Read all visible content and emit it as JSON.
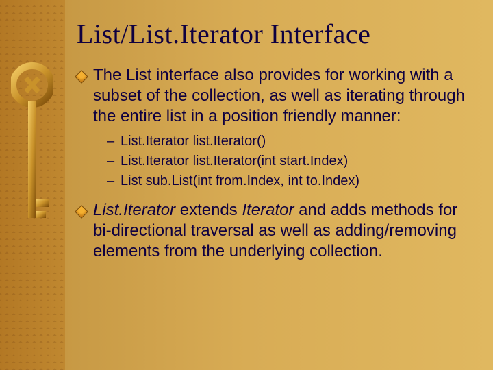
{
  "title": "List/List.Iterator Interface",
  "bullets": [
    {
      "pre": "The ",
      "code": "List",
      "post": " interface also provides for working with a subset of the collection, as well as iterating through the entire list in a position friendly manner:"
    },
    {
      "italA": "List.Iterator",
      "mid": " extends ",
      "italB": "Iterator",
      "post": " and adds methods for bi-directional traversal as well as adding/removing elements from the underlying collection."
    }
  ],
  "sub_items": [
    "List.Iterator list.Iterator()",
    "List.Iterator list.Iterator(int start.Index)",
    "List sub.List(int from.Index, int to.Index)"
  ]
}
